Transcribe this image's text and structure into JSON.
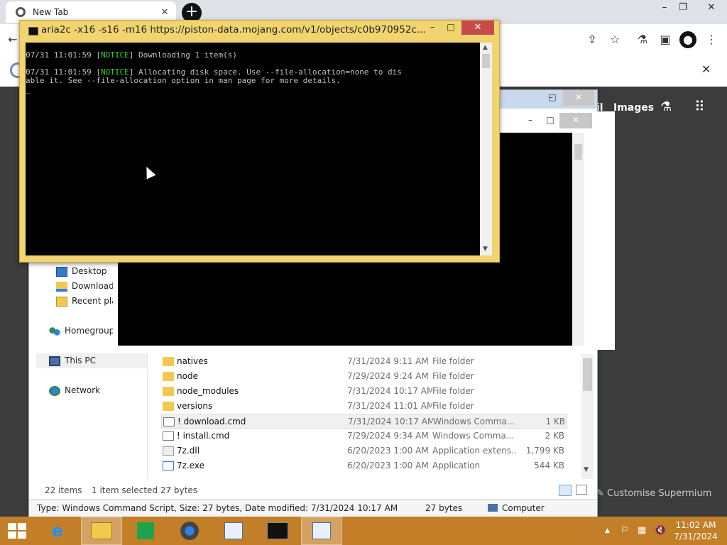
{
  "chrome": {
    "tab_title": "New Tab",
    "tab_close": "✕",
    "new_tab": "+",
    "win_min": "–",
    "win_restore": "❐",
    "win_close": "✕",
    "toolbar_icons": [
      "share-icon",
      "star-icon",
      "extension-icon",
      "sidebar-icon",
      "profile-icon",
      "menu-icon"
    ],
    "bar2_close": "✕",
    "gmail_link": "il",
    "images_link": "Images",
    "customise": "Customise Supermium"
  },
  "aria_window": {
    "title": "aria2c  -x16 -s16 -m16 https://piston-data.mojang.com/v1/objects/c0b970952c...",
    "min": "–",
    "max": "□",
    "close": "✕",
    "lines": [
      {
        "pre": "07/31 11:01:59 [",
        "tag": "NOTICE",
        "post": "] Downloading 1 item(s)"
      },
      {
        "pre": "07/31 11:01:59 [",
        "tag": "NOTICE",
        "post": "] Allocating disk space. Use --file-allocation=none to dis"
      },
      {
        "pre": "able it. See --file-allocation option in man page for more details.",
        "tag": "",
        "post": ""
      },
      {
        "pre": "_",
        "tag": "",
        "post": ""
      }
    ]
  },
  "explorer": {
    "min": "–",
    "max": "□",
    "close": "✕",
    "nav": [
      {
        "label": "Desktop",
        "icon": "desktop-icon"
      },
      {
        "label": "Download",
        "icon": "downloads-folder-icon"
      },
      {
        "label": "Recent pla",
        "icon": "recent-places-icon"
      },
      {
        "label": "Homegroup",
        "icon": "homegroup-icon"
      },
      {
        "label": "This PC",
        "icon": "this-pc-icon"
      },
      {
        "label": "Network",
        "icon": "network-icon"
      }
    ],
    "files": [
      {
        "name": "natives",
        "date": "7/31/2024 9:11 AM",
        "type": "File folder",
        "size": "",
        "kind": "folder"
      },
      {
        "name": "node",
        "date": "7/29/2024 9:24 AM",
        "type": "File folder",
        "size": "",
        "kind": "folder"
      },
      {
        "name": "node_modules",
        "date": "7/31/2024 10:17 AM",
        "type": "File folder",
        "size": "",
        "kind": "folder"
      },
      {
        "name": "versions",
        "date": "7/31/2024 11:01 AM",
        "type": "File folder",
        "size": "",
        "kind": "folder"
      },
      {
        "name": "! download.cmd",
        "date": "7/31/2024 10:17 AM",
        "type": "Windows Comma...",
        "size": "1 KB",
        "kind": "cmd"
      },
      {
        "name": "! install.cmd",
        "date": "7/29/2024 9:34 AM",
        "type": "Windows Comma...",
        "size": "2 KB",
        "kind": "cmd"
      },
      {
        "name": "7z.dll",
        "date": "6/20/2023 1:00 AM",
        "type": "Application extens...",
        "size": "1,799 KB",
        "kind": "dll"
      },
      {
        "name": "7z.exe",
        "date": "6/20/2023 1:00 AM",
        "type": "Application",
        "size": "544 KB",
        "kind": "exe"
      }
    ],
    "status_items": "22 items",
    "status_selected": "1 item selected  27 bytes",
    "details": "Type: Windows Command Script, Size: 27 bytes, Date modified: 7/31/2024 10:17 AM",
    "details_size": "27 bytes",
    "details_location": "Computer"
  },
  "console2": {
    "min": "–",
    "max": "□",
    "close": "✕"
  },
  "taskbar": {
    "apps": [
      "ie-icon",
      "file-explorer-icon",
      "store-icon",
      "chrome-like-icon",
      "notepad-icon",
      "cmd-icon",
      "notepad-icon-2"
    ],
    "clock_time": "11:02 AM",
    "clock_date": "7/31/2024"
  }
}
